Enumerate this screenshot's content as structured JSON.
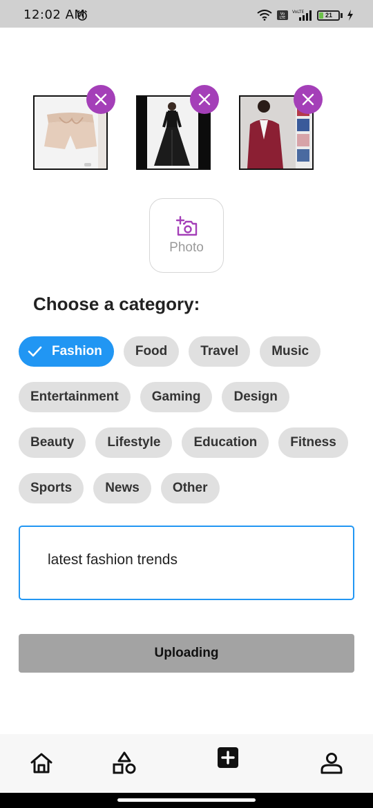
{
  "status_bar": {
    "time": "12:02 AM",
    "battery_level": "21",
    "battery_fraction": 0.21,
    "network_labels": [
      "Vo LTE",
      "VoLTE"
    ]
  },
  "images": [
    {
      "alt": "beige shorts",
      "remove_icon": "close-icon"
    },
    {
      "alt": "black gown",
      "remove_icon": "close-icon"
    },
    {
      "alt": "red blazer",
      "remove_icon": "close-icon"
    }
  ],
  "photo_button": {
    "label": "Photo",
    "icon": "add-photo-icon"
  },
  "category_heading": "Choose a category:",
  "categories": [
    {
      "label": "Fashion",
      "selected": true
    },
    {
      "label": "Food",
      "selected": false
    },
    {
      "label": "Travel",
      "selected": false
    },
    {
      "label": "Music",
      "selected": false
    },
    {
      "label": "Entertainment",
      "selected": false
    },
    {
      "label": "Gaming",
      "selected": false
    },
    {
      "label": "Design",
      "selected": false
    },
    {
      "label": "Beauty",
      "selected": false
    },
    {
      "label": "Lifestyle",
      "selected": false
    },
    {
      "label": "Education",
      "selected": false
    },
    {
      "label": "Fitness",
      "selected": false
    },
    {
      "label": "Sports",
      "selected": false
    },
    {
      "label": "News",
      "selected": false
    },
    {
      "label": "Other",
      "selected": false
    }
  ],
  "caption_input": {
    "value": "latest fashion trends"
  },
  "upload_button": {
    "label": "Uploading"
  },
  "bottom_nav": [
    "home-icon",
    "categories-icon",
    "add-icon",
    "profile-icon"
  ],
  "colors": {
    "accent": "#2196f3",
    "remove": "#a43fb8",
    "chip_bg": "#e0e0e0",
    "upload_disabled": "#a3a3a3"
  }
}
